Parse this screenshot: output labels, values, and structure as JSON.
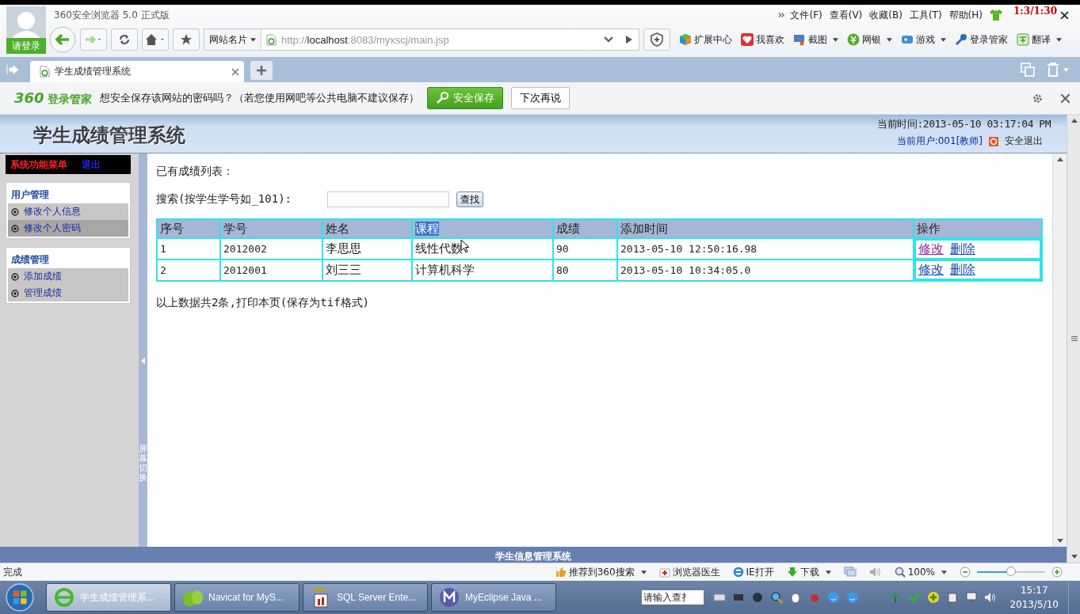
{
  "browser": {
    "title": "360安全浏览器 5.0 正式版",
    "login": "请登录",
    "menu": [
      "文件(F)",
      "查看(V)",
      "收藏(B)",
      "工具(T)",
      "帮助(H)"
    ],
    "overlay": "1:3/1:30",
    "card_label": "网站名片",
    "url_parts": [
      {
        "text": "http://",
        "kind": "dim"
      },
      {
        "text": "localhost",
        "kind": "host"
      },
      {
        "text": ":8083/myxscj/main.jsp",
        "kind": "dim"
      }
    ],
    "toolbar": [
      {
        "kind": "cube",
        "label": "扩展中心",
        "dropdown": false
      },
      {
        "kind": "heart",
        "label": "我喜欢",
        "dropdown": false
      },
      {
        "kind": "screen",
        "label": "截图",
        "dropdown": true
      },
      {
        "kind": "coin",
        "label": "网银",
        "dropdown": true
      },
      {
        "kind": "gamepad",
        "label": "游戏",
        "dropdown": true
      },
      {
        "kind": "key",
        "label": "登录管家",
        "dropdown": false
      },
      {
        "kind": "translate",
        "label": "翻译",
        "dropdown": true
      }
    ],
    "tabs": [
      {
        "title": "学生成绩管理系统",
        "selected": true
      }
    ],
    "password_bar": {
      "brand": "360",
      "brand_label": "登录管家",
      "message": "想安全保存该网站的密码吗？（若您使用网吧等公共电脑不建议保存）",
      "save": "安全保存",
      "later": "下次再说"
    }
  },
  "page": {
    "title": "学生成绩管理系统",
    "time": "当前时间:2013-05-10 03:17:04 PM",
    "user": "当前用户:001[教师]",
    "logout": "安全退出",
    "sidebar": {
      "menu_title": "系统功能菜单",
      "exit": "退出",
      "groups": [
        {
          "title": "用户管理",
          "items": [
            {
              "label": "修改个人信息",
              "selected": false
            },
            {
              "label": "修改个人密码",
              "selected": true
            }
          ]
        },
        {
          "title": "成绩管理",
          "items": [
            {
              "label": "添加成绩",
              "selected": false
            },
            {
              "label": "管理成绩",
              "selected": false
            }
          ]
        }
      ]
    },
    "splitter": "屏幕切换",
    "heading": "已有成绩列表：",
    "search_label": "搜索(按学生学号如_101):",
    "search_button": "查找",
    "table": {
      "columns": [
        {
          "label": "序号",
          "highlighted": false
        },
        {
          "label": "学号",
          "highlighted": false
        },
        {
          "label": "姓名",
          "highlighted": false
        },
        {
          "label": "课程",
          "highlighted": true
        },
        {
          "label": "成绩",
          "highlighted": false
        },
        {
          "label": "添加时间",
          "highlighted": false
        },
        {
          "label": "操作",
          "highlighted": false
        }
      ],
      "rows": [
        {
          "cells": [
            "1",
            "2012002",
            "李思思",
            "线性代数",
            "90",
            "2013-05-10 12:50:16.98"
          ],
          "actions": [
            {
              "label": "修改",
              "visited": true
            },
            {
              "label": "删除",
              "visited": false
            }
          ]
        },
        {
          "cells": [
            "2",
            "2012001",
            "刘三三",
            "计算机科学",
            "80",
            "2013-05-10 10:34:05.0"
          ],
          "actions": [
            {
              "label": "修改",
              "visited": false
            },
            {
              "label": "删除",
              "visited": false
            }
          ]
        }
      ]
    },
    "summary": "以上数据共2条,打印本页(保存为tif格式)",
    "footer": "学生信息管理系统"
  },
  "status_bar": {
    "text": "完成",
    "items": [
      {
        "kind": "thumb",
        "label": "推荐到360搜索",
        "dropdown": true
      },
      {
        "kind": "medkit",
        "label": "浏览器医生",
        "dropdown": false
      },
      {
        "kind": "ie",
        "label": "IE打开",
        "dropdown": false
      },
      {
        "kind": "download",
        "label": "下载",
        "dropdown": true
      }
    ],
    "zoom": "100%",
    "zoom_level": {
      "level": 0.5
    }
  },
  "taskbar": {
    "items": [
      {
        "kind": "ie",
        "label": "学生成绩管理系...",
        "selected": true
      },
      {
        "kind": "navicat",
        "label": "Navicat for MyS...",
        "selected": false
      },
      {
        "kind": "sqlserver",
        "label": "SQL Server Ente...",
        "selected": false
      },
      {
        "kind": "myeclipse",
        "label": "MyEclipse Java ...",
        "selected": false
      }
    ],
    "search_placeholder": "请输入查扌",
    "time": "15:17",
    "date": "2013/5/10"
  }
}
